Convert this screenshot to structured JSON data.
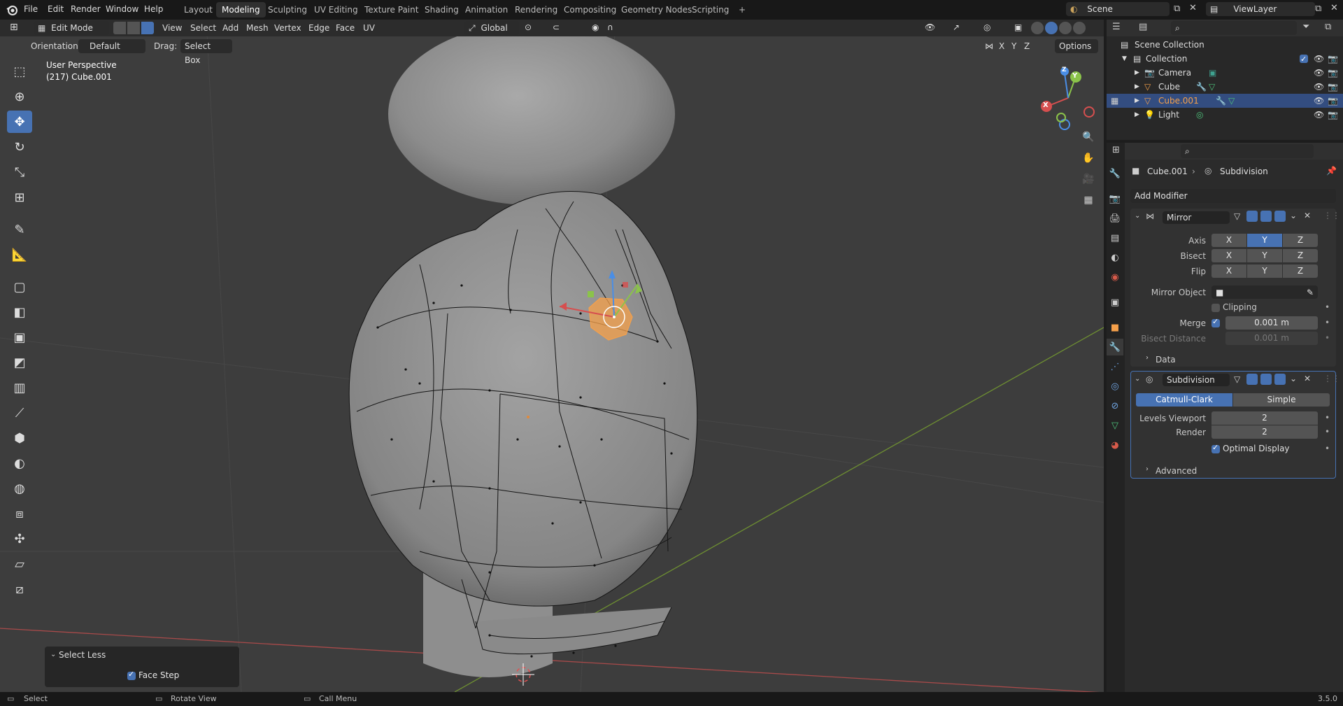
{
  "topbar": {
    "menus": [
      "File",
      "Edit",
      "Render",
      "Window",
      "Help"
    ],
    "workspaces": [
      "Layout",
      "Modeling",
      "Sculpting",
      "UV Editing",
      "Texture Paint",
      "Shading",
      "Animation",
      "Rendering",
      "Compositing",
      "Geometry Nodes",
      "Scripting"
    ],
    "active_workspace": "Modeling",
    "add_tab": "+",
    "scene": "Scene",
    "view_layer": "ViewLayer"
  },
  "viewport_header": {
    "mode": "Edit Mode",
    "menus": [
      "View",
      "Select",
      "Add",
      "Mesh",
      "Vertex",
      "Edge",
      "Face",
      "UV"
    ],
    "transform_orientation": "Global",
    "orientation_label": "Orientation:",
    "orientation_value": "Default",
    "drag_label": "Drag:",
    "drag_value": "Select Box",
    "options": "Options",
    "axis_x": "X",
    "axis_y": "Y",
    "axis_z": "Z"
  },
  "viewport": {
    "perspective": "User Perspective",
    "object_info": "(217) Cube.001",
    "gizmo_x": "X",
    "gizmo_y": "Y",
    "gizmo_z": "Z"
  },
  "tools": [
    "select-box",
    "cursor",
    "move",
    "rotate",
    "scale",
    "transform",
    "annotate",
    "measure",
    "add-cube",
    "extrude",
    "inset",
    "bevel",
    "loop-cut",
    "knife",
    "poly-build",
    "spin",
    "smooth",
    "edge-slide",
    "shrink-fatten",
    "shear",
    "rip-region"
  ],
  "redo_panel": {
    "title": "Select Less",
    "option": "Face Step",
    "option_checked": true
  },
  "outliner": {
    "root": "Scene Collection",
    "collection": "Collection",
    "items": [
      {
        "name": "Camera",
        "selected": false
      },
      {
        "name": "Cube",
        "selected": false
      },
      {
        "name": "Cube.001",
        "selected": true
      },
      {
        "name": "Light",
        "selected": false
      }
    ]
  },
  "properties": {
    "breadcrumb_object": "Cube.001",
    "breadcrumb_modifier": "Subdivision",
    "add_modifier": "Add Modifier",
    "mirror": {
      "name": "Mirror",
      "axis_label": "Axis",
      "bisect_label": "Bisect",
      "flip_label": "Flip",
      "x": "X",
      "y": "Y",
      "z": "Z",
      "mirror_object_label": "Mirror Object",
      "clipping": "Clipping",
      "merge_label": "Merge",
      "merge_value": "0.001 m",
      "bisect_distance_label": "Bisect Distance",
      "bisect_distance_value": "0.001 m",
      "data_section": "Data"
    },
    "subdivision": {
      "name": "Subdivision",
      "catmull": "Catmull-Clark",
      "simple": "Simple",
      "levels_viewport_label": "Levels Viewport",
      "levels_viewport_value": "2",
      "render_label": "Render",
      "render_value": "2",
      "optimal_display": "Optimal Display",
      "advanced_section": "Advanced"
    }
  },
  "statusbar": {
    "select": "Select",
    "rotate_view": "Rotate View",
    "call_menu": "Call Menu",
    "version": "3.5.0"
  },
  "colors": {
    "accent": "#4772b3",
    "selected_orange": "#f5a04a",
    "x_axis": "#d64f4f",
    "y_axis": "#8bc34a",
    "z_axis": "#4a8ee6"
  }
}
